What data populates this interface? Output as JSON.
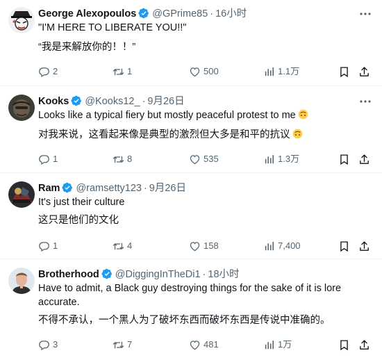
{
  "icons": {
    "verified": "verified-badge-icon",
    "more": "more-horizontal-icon",
    "reply": "reply-icon",
    "retweet": "retweet-icon",
    "like": "like-icon",
    "views": "views-icon",
    "bookmark": "bookmark-icon",
    "share": "share-icon",
    "emoji": "upside-down-face-emoji"
  },
  "colors": {
    "verified": "#1d9bf0",
    "muted": "#536471",
    "text": "#0f1419",
    "divider": "#eff3f4"
  },
  "tweets": [
    {
      "name": "George Alexopoulos",
      "handle": "@GPrime85",
      "time": "16小时",
      "lines": [
        "\"I'M HERE TO LIBERATE YOU!!\"",
        "“我是来解放你的！！”"
      ],
      "replies": "2",
      "retweets": "1",
      "likes": "500",
      "views": "1.1万"
    },
    {
      "name": "Kooks",
      "handle": "@Kooks12_",
      "time": "9月26日",
      "lines": [
        "Looks like a typical fiery but mostly peaceful protest to me",
        "对我来说，这看起来像是典型的激烈但大多是和平的抗议"
      ],
      "replies": "1",
      "retweets": "8",
      "likes": "535",
      "views": "1.3万"
    },
    {
      "name": "Ram",
      "handle": "@ramsetty123",
      "time": "9月26日",
      "lines": [
        "It's just their culture",
        "这只是他们的文化"
      ],
      "replies": "1",
      "retweets": "4",
      "likes": "158",
      "views": "7,400"
    },
    {
      "name": "Brotherhood",
      "handle": "@DiggingInTheDi1",
      "time": "18小时",
      "lines": [
        "Have to admit, a Black guy destroying things for the sake of it is lore",
        "accurate.",
        "不得不承认，一个黑人为了破坏东西而破坏东西是传说中准确的。"
      ],
      "replies": "3",
      "retweets": "7",
      "likes": "481",
      "views": "1万"
    }
  ]
}
